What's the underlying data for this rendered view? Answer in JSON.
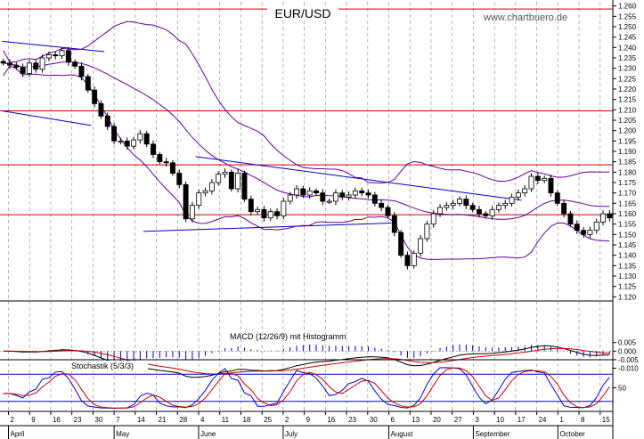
{
  "title": "EUR/USD",
  "watermark": "www.chartbuero.de",
  "macd_label": "MACD (12/26/9) mit Histogramm",
  "stoch_label": "Stochastik (5/3/3)",
  "colors": {
    "candle": "#000000",
    "bollinger": "#660099",
    "resistance": "#cc0000",
    "trendline": "#0000cc",
    "macd": "#000000",
    "signal": "#cc0000",
    "histogram": "#0000cc",
    "stoch_k": "#0000cc",
    "stoch_d": "#cc0000",
    "grid": "#999999"
  },
  "chart_data": [
    {
      "type": "candlestick",
      "title": "EUR/USD",
      "ylim": [
        1.118,
        1.262
      ],
      "yticks": [
        1.12,
        1.125,
        1.13,
        1.135,
        1.14,
        1.145,
        1.15,
        1.155,
        1.16,
        1.165,
        1.17,
        1.175,
        1.18,
        1.185,
        1.19,
        1.195,
        1.2,
        1.205,
        1.21,
        1.215,
        1.22,
        1.225,
        1.23,
        1.235,
        1.24,
        1.245,
        1.25,
        1.255,
        1.26
      ],
      "ytick_labels": [
        "1.120",
        "1.125",
        "1.130",
        "1.135",
        "1.140",
        "1.145",
        "1.150",
        "1.155",
        "1.160",
        "1.165",
        "1.170",
        "1.175",
        "1.180",
        "1.185",
        "1.190",
        "1.195",
        "1.200",
        "1.205",
        "1.210",
        "1.215",
        "1.220",
        "1.225",
        "1.230",
        "1.235",
        "1.240",
        "1.245",
        "1.250",
        "1.255",
        "1.260"
      ],
      "x_labels": [
        "2",
        "9",
        "16",
        "23",
        "30",
        "7",
        "14",
        "21",
        "28",
        "4",
        "11",
        "18",
        "25",
        "2",
        "9",
        "16",
        "23",
        "30",
        "6",
        "13",
        "20",
        "27",
        "3",
        "10",
        "17",
        "24",
        "1",
        "8",
        "15"
      ],
      "months": [
        "April",
        "May",
        "June",
        "July",
        "August",
        "September",
        "October"
      ],
      "month_start_index": [
        0,
        5,
        9,
        13,
        18,
        22,
        26
      ],
      "horizontal_lines": [
        1.2585,
        1.2095,
        1.1835,
        1.1595
      ],
      "trend_lines": [
        {
          "from": [
            -0.2,
            1.243
          ],
          "to": [
            15.5,
            1.238
          ]
        },
        {
          "from": [
            -0.2,
            1.2095
          ],
          "to": [
            13.5,
            1.2025
          ]
        },
        {
          "from": [
            29.5,
            1.1875
          ],
          "to": [
            79.5,
            1.1665
          ]
        },
        {
          "from": [
            21.5,
            1.1515
          ],
          "to": [
            59.5,
            1.1555
          ]
        }
      ],
      "closes": [
        1.2325,
        1.2315,
        1.2305,
        1.2275,
        1.2325,
        1.2295,
        1.235,
        1.2365,
        1.236,
        1.2385,
        1.233,
        1.231,
        1.226,
        1.2195,
        1.213,
        1.207,
        1.202,
        1.195,
        1.195,
        1.1925,
        1.1955,
        1.1985,
        1.1935,
        1.1885,
        1.185,
        1.1845,
        1.1795,
        1.174,
        1.1575,
        1.164,
        1.17,
        1.171,
        1.175,
        1.179,
        1.18,
        1.172,
        1.1795,
        1.167,
        1.161,
        1.162,
        1.158,
        1.161,
        1.159,
        1.166,
        1.169,
        1.172,
        1.169,
        1.171,
        1.17,
        1.166,
        1.166,
        1.17,
        1.168,
        1.169,
        1.171,
        1.17,
        1.169,
        1.165,
        1.163,
        1.159,
        1.151,
        1.14,
        1.135,
        1.141,
        1.148,
        1.155,
        1.16,
        1.163,
        1.164,
        1.165,
        1.167,
        1.164,
        1.162,
        1.16,
        1.159,
        1.162,
        1.164,
        1.165,
        1.168,
        1.17,
        1.172,
        1.178,
        1.176,
        1.177,
        1.17,
        1.165,
        1.16,
        1.155,
        1.152,
        1.15,
        1.152,
        1.156,
        1.16,
        1.158
      ],
      "indicators": [
        "Bollinger Bands",
        "Horizontal resistance lines",
        "Trend lines"
      ]
    },
    {
      "type": "line",
      "title": "MACD (12/26/9) mit Histogramm",
      "ylim": [
        -0.016,
        0.0085
      ],
      "yticks": [
        0.005,
        0.0,
        -0.005,
        -0.01
      ],
      "ytick_labels": [
        "0.005",
        "0.000",
        "-0.005",
        "-0.010"
      ],
      "series": [
        "MACD",
        "Signal",
        "Histogram"
      ]
    },
    {
      "type": "line",
      "title": "Stochastik (5/3/3)",
      "ylim": [
        0,
        100
      ],
      "yticks": [
        50
      ],
      "ytick_labels": [
        "50"
      ],
      "reference_lines": [
        20,
        80
      ],
      "series": [
        "%K",
        "%D"
      ]
    }
  ]
}
